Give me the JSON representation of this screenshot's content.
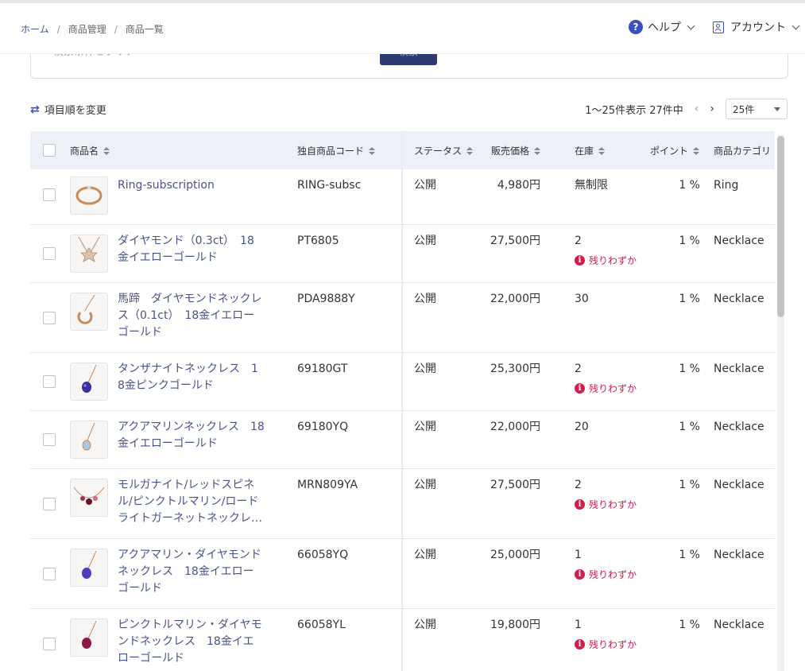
{
  "breadcrumb": {
    "home": "ホーム",
    "section": "商品管理",
    "current": "商品一覧",
    "separator": "/"
  },
  "header": {
    "help_label": "ヘルプ",
    "account_label": "アカウント"
  },
  "search_panel": {
    "ghost_text": "検索条件をクリア",
    "button_label": "検索"
  },
  "toolbar": {
    "reorder_label": "項目順を変更",
    "range_text": "1〜25件表示 27件中",
    "prev_arrow": "‹",
    "next_arrow": "›",
    "per_page": "25件"
  },
  "columns": {
    "name": "商品名",
    "code": "独自商品コード",
    "status": "ステータス",
    "price": "販売価格",
    "stock": "在庫",
    "point": "ポイント",
    "category": "商品カテゴリ"
  },
  "low_stock_label": "残りわずか",
  "colors": {
    "accent": "#3a4fc2",
    "link": "#45548a",
    "warning": "#d21c4b",
    "header_bg": "#edf0f7"
  },
  "products": [
    {
      "name": "Ring-subscription",
      "code": "RING-subsc",
      "status": "公開",
      "price": "4,980円",
      "stock": "無制限",
      "low": false,
      "point": "1 %",
      "category": "Ring"
    },
    {
      "name": "ダイヤモンド（0.3ct）　18金イエローゴールド",
      "code": "PT6805",
      "status": "公開",
      "price": "27,500円",
      "stock": "2",
      "low": true,
      "point": "1 %",
      "category": "Necklace"
    },
    {
      "name": "馬蹄　ダイヤモンドネックレス（0.1ct）　18金イエローゴールド",
      "code": "PDA9888Y",
      "status": "公開",
      "price": "22,000円",
      "stock": "30",
      "low": false,
      "point": "1 %",
      "category": "Necklace"
    },
    {
      "name": "タンザナイトネックレス　18金ピンクゴールド",
      "code": "69180GT",
      "status": "公開",
      "price": "25,300円",
      "stock": "2",
      "low": true,
      "point": "1 %",
      "category": "Necklace"
    },
    {
      "name": "アクアマリンネックレス　18金イエローゴールド",
      "code": "69180YQ",
      "status": "公開",
      "price": "22,000円",
      "stock": "20",
      "low": false,
      "point": "1 %",
      "category": "Necklace"
    },
    {
      "name": "モルガナイト/レッドスピネル/ピンクトルマリン/ロードライトガーネットネックレ…",
      "code": "MRN809YA",
      "status": "公開",
      "price": "27,500円",
      "stock": "2",
      "low": true,
      "point": "1 %",
      "category": "Necklace"
    },
    {
      "name": "アクアマリン・ダイヤモンドネックレス　18金イエローゴールド",
      "code": "66058YQ",
      "status": "公開",
      "price": "25,000円",
      "stock": "1",
      "low": true,
      "point": "1 %",
      "category": "Necklace"
    },
    {
      "name": "ピンクトルマリン・ダイヤモンドネックレス　18金イエローゴールド",
      "code": "66058YL",
      "status": "公開",
      "price": "19,800円",
      "stock": "1",
      "low": true,
      "point": "1 %",
      "category": "Necklace"
    }
  ]
}
